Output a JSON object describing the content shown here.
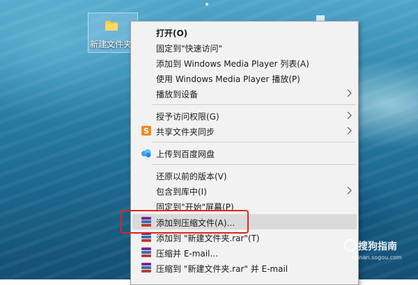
{
  "desktop": {
    "folder_label": "新建文件夹"
  },
  "context_menu": {
    "items": [
      {
        "label": "打开(O)",
        "bold": true
      },
      {
        "label": "固定到\"快速访问\""
      },
      {
        "label": "添加到 Windows Media Player 列表(A)"
      },
      {
        "label": "使用 Windows Media Player 播放(P)"
      },
      {
        "label": "播放到设备",
        "submenu": true
      },
      {
        "label": "授予访问权限(G)",
        "submenu": true
      },
      {
        "label": "共享文件夹同步",
        "icon": "sync-share-icon",
        "submenu": true
      },
      {
        "label": "上传到百度网盘",
        "icon": "baidu-netdisk-icon"
      },
      {
        "label": "还原以前的版本(V)"
      },
      {
        "label": "包含到库中(I)",
        "submenu": true
      },
      {
        "label": "固定到\"开始\"屏幕(P)"
      },
      {
        "label": "添加到压缩文件(A)...",
        "icon": "winrar-icon",
        "highlighted": true
      },
      {
        "label": "添加到 \"新建文件夹.rar\"(T)",
        "icon": "winrar-icon"
      },
      {
        "label": "压缩并 E-mail...",
        "icon": "winrar-icon"
      },
      {
        "label": "压缩到 \"新建文件夹.rar\" 并 E-mail",
        "icon": "winrar-icon"
      }
    ]
  },
  "watermark": {
    "text": "搜狗指南",
    "url": "zhinan.sogou.com"
  },
  "colors": {
    "highlight_box": "#e0251b",
    "menu_background": "#f2f2f2"
  }
}
